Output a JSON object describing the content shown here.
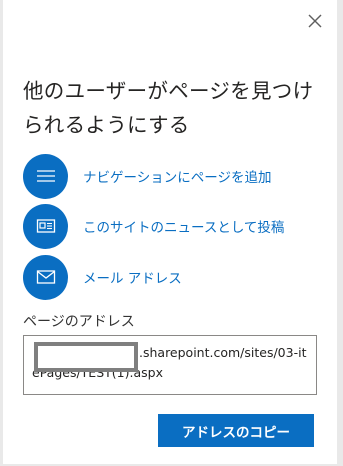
{
  "dialog": {
    "close_icon": "close-icon",
    "title": "他のユーザーがページを見つけられるようにする",
    "accent_color": "#0a6ec2",
    "actions": [
      {
        "label": "ナビゲーションにページを追加",
        "icon": "navigation-lines-icon"
      },
      {
        "label": "このサイトのニュースとして投稿",
        "icon": "news-icon"
      },
      {
        "label": "メール アドレス",
        "icon": "mail-icon"
      }
    ],
    "address": {
      "label": "ページのアドレス",
      "value": ".sharepoint.com/sites/03-itePages/TEST(1).aspx"
    },
    "copy_button_label": "アドレスのコピー"
  }
}
